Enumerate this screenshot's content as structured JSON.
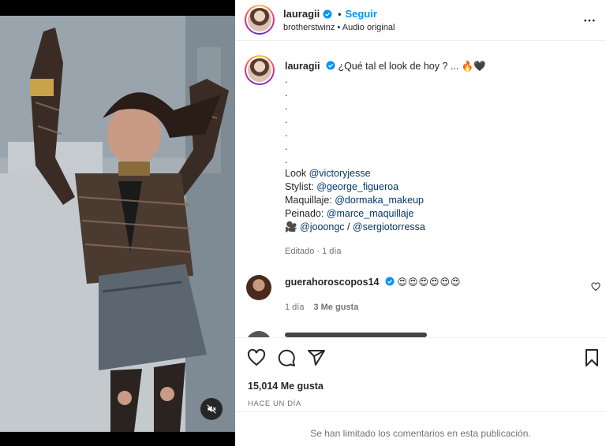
{
  "post": {
    "username": "lauragii",
    "follow_label": "Seguir",
    "dot": "•",
    "audio_line": "brotherstwinz • Audio original"
  },
  "caption": {
    "username": "lauragii",
    "text": "¿Qué tal el look de hoy ? ... 🔥🖤",
    "dots": [
      ".",
      ".",
      ".",
      ".",
      ".",
      ".",
      "."
    ],
    "credits": [
      {
        "label": "Look ",
        "mentions": [
          "@victoryjesse"
        ]
      },
      {
        "label": "Stylist: ",
        "mentions": [
          "@george_figueroa"
        ]
      },
      {
        "label": "Maquillaje: ",
        "mentions": [
          "@dormaka_makeup"
        ]
      },
      {
        "label": "Peinado: ",
        "mentions": [
          "@marce_maquillaje"
        ]
      },
      {
        "label": "🎥 ",
        "mentions": [
          "@jooongc",
          "@sergiotorressa"
        ],
        "separator": " / "
      }
    ],
    "edited": "Editado · 1 día"
  },
  "comment": {
    "username": "guerahoroscopos14",
    "text": "😍😍😍😍😍😍",
    "time": "1 día",
    "likes": "3 Me gusta"
  },
  "stats": {
    "likes": "15,014 Me gusta",
    "date": "HACE UN DÍA"
  },
  "footer": {
    "limited": "Se han limitado los comentarios en esta publicación."
  },
  "colors": {
    "accent": "#0095f6",
    "mention": "#00376b",
    "muted": "#737373"
  },
  "icons": [
    "more-icon",
    "verified-icon",
    "heart-icon",
    "comment-icon",
    "share-icon",
    "save-icon",
    "mute-icon"
  ]
}
